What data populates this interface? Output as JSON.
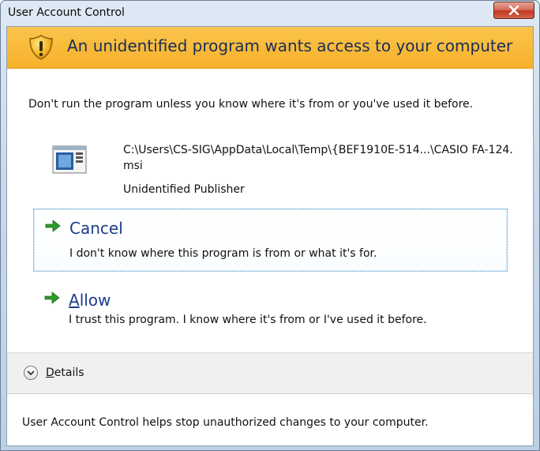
{
  "window": {
    "title": "User Account Control",
    "close_symbol": "X"
  },
  "banner": {
    "icon": "shield-warning-icon",
    "text": "An unidentified program wants access to your computer",
    "color": "#f6b12a"
  },
  "warning": "Don't run the program unless you know where it's from or you've used it before.",
  "program": {
    "icon": "program-window-icon",
    "path": "C:\\Users\\CS-SIG\\AppData\\Local\\Temp\\{BEF1910E-514...\\CASIO FA-124.msi",
    "publisher": "Unidentified Publisher"
  },
  "options": {
    "cancel": {
      "title": "Cancel",
      "description": "I don't know where this program is from or what it's for."
    },
    "allow": {
      "title_accel": "A",
      "title_rest": "llow",
      "description": "I trust this program. I know where it's from or I've used it before."
    }
  },
  "details": {
    "accel": "D",
    "rest": "etails"
  },
  "footer": "User Account Control helps stop unauthorized changes to your computer.",
  "colors": {
    "arrow_green": "#2a9a2a",
    "link_blue": "#1b3c8a",
    "close_red": "#c0391f"
  }
}
